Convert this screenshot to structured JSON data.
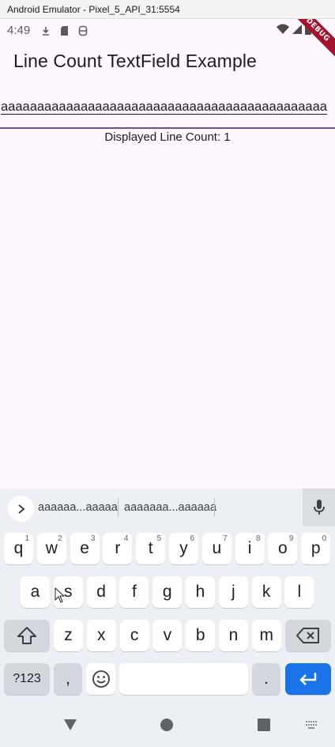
{
  "window": {
    "title": "Android Emulator - Pixel_5_API_31:5554"
  },
  "status_bar": {
    "time": "4:49",
    "left_icons": [
      "download-icon",
      "sd-card-icon",
      "accessibility-icon"
    ],
    "right_icons": [
      "wifi-icon",
      "cellular-signal-icon",
      "battery-icon"
    ]
  },
  "debug_banner": "DEBUG",
  "app": {
    "title": "Line Count TextField Example",
    "textfield_value": "aaaaaaaaaaaaaaaaaaaaaaaaaaaaaaaaaaaaaaaaaaaaa",
    "line_count_label": "Displayed Line Count: 1"
  },
  "keyboard": {
    "suggestions": [
      "aaaaaa...aaaaa",
      "aaaaaaa...aaaaaa"
    ],
    "row1": [
      {
        "k": "q",
        "h": "1"
      },
      {
        "k": "w",
        "h": "2"
      },
      {
        "k": "e",
        "h": "3"
      },
      {
        "k": "r",
        "h": "4"
      },
      {
        "k": "t",
        "h": "5"
      },
      {
        "k": "y",
        "h": "6"
      },
      {
        "k": "u",
        "h": "7"
      },
      {
        "k": "i",
        "h": "8"
      },
      {
        "k": "o",
        "h": "9"
      },
      {
        "k": "p",
        "h": "0"
      }
    ],
    "row2": [
      "a",
      "s",
      "d",
      "f",
      "g",
      "h",
      "j",
      "k",
      "l"
    ],
    "row3": [
      "z",
      "x",
      "c",
      "v",
      "b",
      "n",
      "m"
    ],
    "symbols_key": "?123",
    "comma_key": ",",
    "period_key": "."
  },
  "colors": {
    "accent": "#6750a4",
    "enter_key": "#1a73e8",
    "debug": "#a3152c"
  }
}
